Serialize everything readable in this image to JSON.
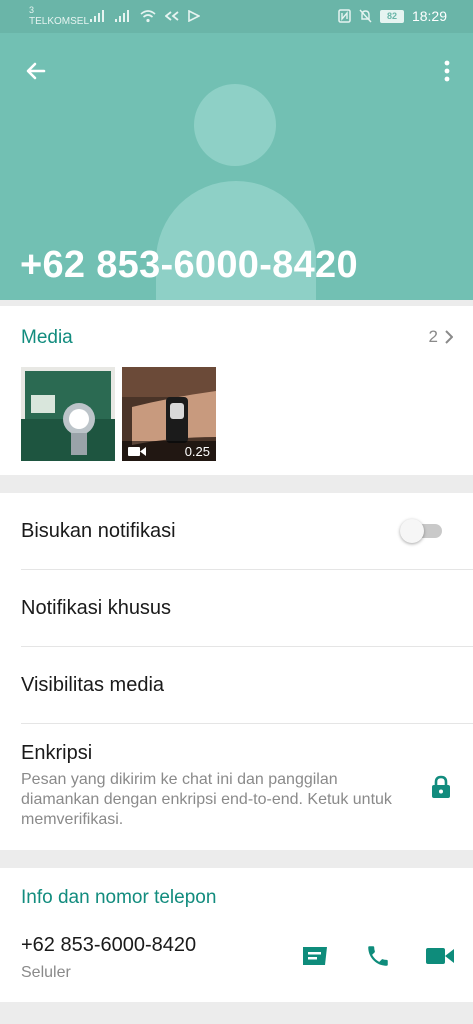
{
  "status_bar": {
    "carrier_number": "3",
    "carrier": "TELKOMSEL",
    "battery": "82",
    "time": "18:29"
  },
  "header": {
    "title": "+62 853-6000-8420",
    "back_icon": "arrow-left-icon",
    "menu_icon": "more-vert-icon"
  },
  "media": {
    "title": "Media",
    "count": "2",
    "items": [
      {
        "type": "image"
      },
      {
        "type": "video",
        "duration": "0.25"
      }
    ]
  },
  "settings": {
    "mute_label": "Bisukan notifikasi",
    "mute_on": false,
    "custom_notif_label": "Notifikasi khusus",
    "media_visibility_label": "Visibilitas media",
    "encryption_title": "Enkripsi",
    "encryption_desc": "Pesan yang dikirim ke chat ini dan panggilan diamankan dengan enkripsi end-to-end. Ketuk untuk memverifikasi."
  },
  "info": {
    "title": "Info dan nomor telepon",
    "number": "+62 853-6000-8420",
    "type": "Seluler"
  },
  "colors": {
    "header": "#72c0b3",
    "accent": "#128c7e",
    "action_icon": "#0e8c7b"
  }
}
